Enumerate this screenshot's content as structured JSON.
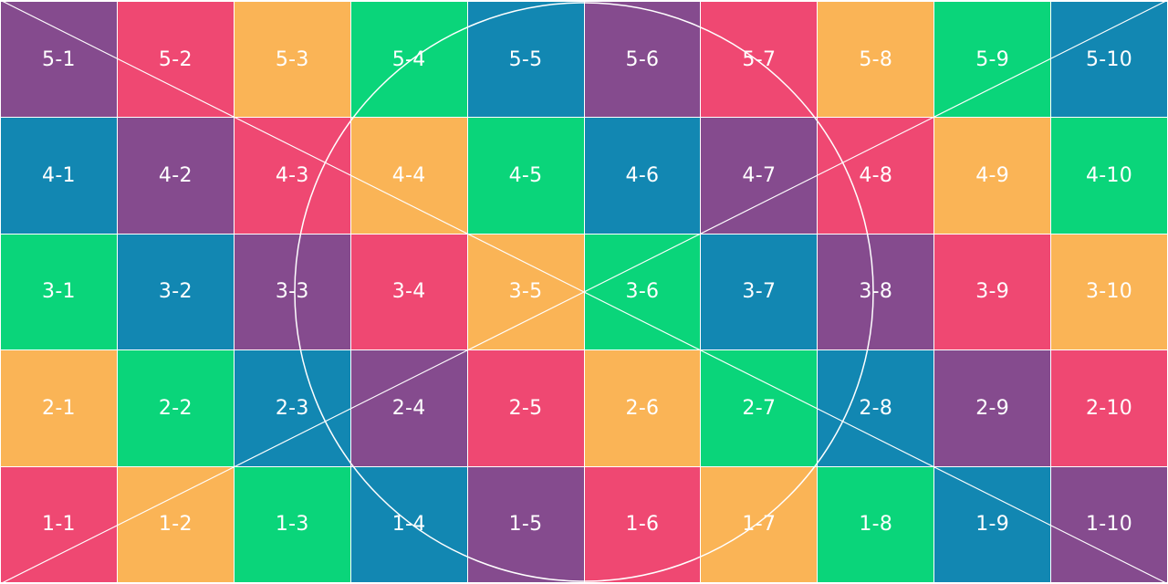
{
  "palette": {
    "purple": "#854b8e",
    "pink": "#ef4872",
    "orange": "#fab456",
    "green": "#0ad57a",
    "blue": "#1287b2",
    "line": "#ffffff",
    "gap": "#ffffff"
  },
  "rows": [
    {
      "cells": [
        {
          "label": "5-1",
          "color": "purple"
        },
        {
          "label": "5-2",
          "color": "pink"
        },
        {
          "label": "5-3",
          "color": "orange"
        },
        {
          "label": "5-4",
          "color": "green"
        },
        {
          "label": "5-5",
          "color": "blue"
        },
        {
          "label": "5-6",
          "color": "purple"
        },
        {
          "label": "5-7",
          "color": "pink"
        },
        {
          "label": "5-8",
          "color": "orange"
        },
        {
          "label": "5-9",
          "color": "green"
        },
        {
          "label": "5-10",
          "color": "blue"
        }
      ]
    },
    {
      "cells": [
        {
          "label": "4-1",
          "color": "blue"
        },
        {
          "label": "4-2",
          "color": "purple"
        },
        {
          "label": "4-3",
          "color": "pink"
        },
        {
          "label": "4-4",
          "color": "orange"
        },
        {
          "label": "4-5",
          "color": "green"
        },
        {
          "label": "4-6",
          "color": "blue"
        },
        {
          "label": "4-7",
          "color": "purple"
        },
        {
          "label": "4-8",
          "color": "pink"
        },
        {
          "label": "4-9",
          "color": "orange"
        },
        {
          "label": "4-10",
          "color": "green"
        }
      ]
    },
    {
      "cells": [
        {
          "label": "3-1",
          "color": "green"
        },
        {
          "label": "3-2",
          "color": "blue"
        },
        {
          "label": "3-3",
          "color": "purple"
        },
        {
          "label": "3-4",
          "color": "pink"
        },
        {
          "label": "3-5",
          "color": "orange"
        },
        {
          "label": "3-6",
          "color": "green"
        },
        {
          "label": "3-7",
          "color": "blue"
        },
        {
          "label": "3-8",
          "color": "purple"
        },
        {
          "label": "3-9",
          "color": "pink"
        },
        {
          "label": "3-10",
          "color": "orange"
        }
      ]
    },
    {
      "cells": [
        {
          "label": "2-1",
          "color": "orange"
        },
        {
          "label": "2-2",
          "color": "green"
        },
        {
          "label": "2-3",
          "color": "blue"
        },
        {
          "label": "2-4",
          "color": "purple"
        },
        {
          "label": "2-5",
          "color": "pink"
        },
        {
          "label": "2-6",
          "color": "orange"
        },
        {
          "label": "2-7",
          "color": "green"
        },
        {
          "label": "2-8",
          "color": "blue"
        },
        {
          "label": "2-9",
          "color": "purple"
        },
        {
          "label": "2-10",
          "color": "pink"
        }
      ]
    },
    {
      "cells": [
        {
          "label": "1-1",
          "color": "pink"
        },
        {
          "label": "1-2",
          "color": "orange"
        },
        {
          "label": "1-3",
          "color": "green"
        },
        {
          "label": "1-4",
          "color": "blue"
        },
        {
          "label": "1-5",
          "color": "purple"
        },
        {
          "label": "1-6",
          "color": "pink"
        },
        {
          "label": "1-7",
          "color": "orange"
        },
        {
          "label": "1-8",
          "color": "green"
        },
        {
          "label": "1-9",
          "color": "blue"
        },
        {
          "label": "1-10",
          "color": "purple"
        }
      ]
    }
  ],
  "overlay": {
    "diagonals": true,
    "circle": true
  }
}
